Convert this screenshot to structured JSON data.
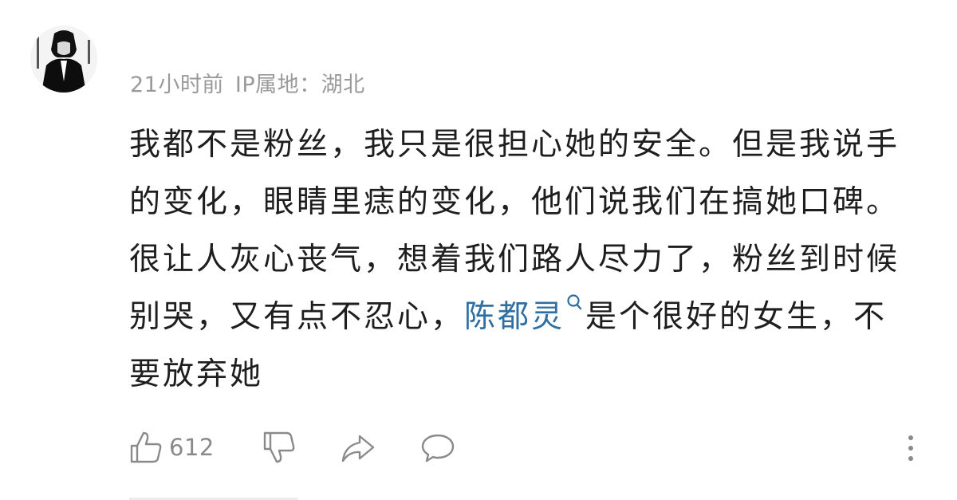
{
  "comment": {
    "timestamp": "21小时前",
    "ip_label": "IP属地：湖北",
    "text_before_mention": "我都不是粉丝，我只是很担心她的安全。但是我说手的变化，眼睛里痣的变化，他们说我们在搞她口碑。很让人灰心丧气，想着我们路人尽力了，粉丝到时候别哭，又有点不忍心，",
    "mention": "陈都灵",
    "text_after_mention": "是个很好的女生，不要放弃她"
  },
  "actions": {
    "like_count": "612",
    "icons": [
      "thumbs-up-icon",
      "thumbs-down-icon",
      "share-icon",
      "comment-icon",
      "more-vertical-icon"
    ]
  },
  "colors": {
    "mention": "#2f6fa3",
    "meta_text": "#9a9a9a",
    "body_text": "#1e1e1e",
    "icon_gray": "#8a8a8a"
  }
}
